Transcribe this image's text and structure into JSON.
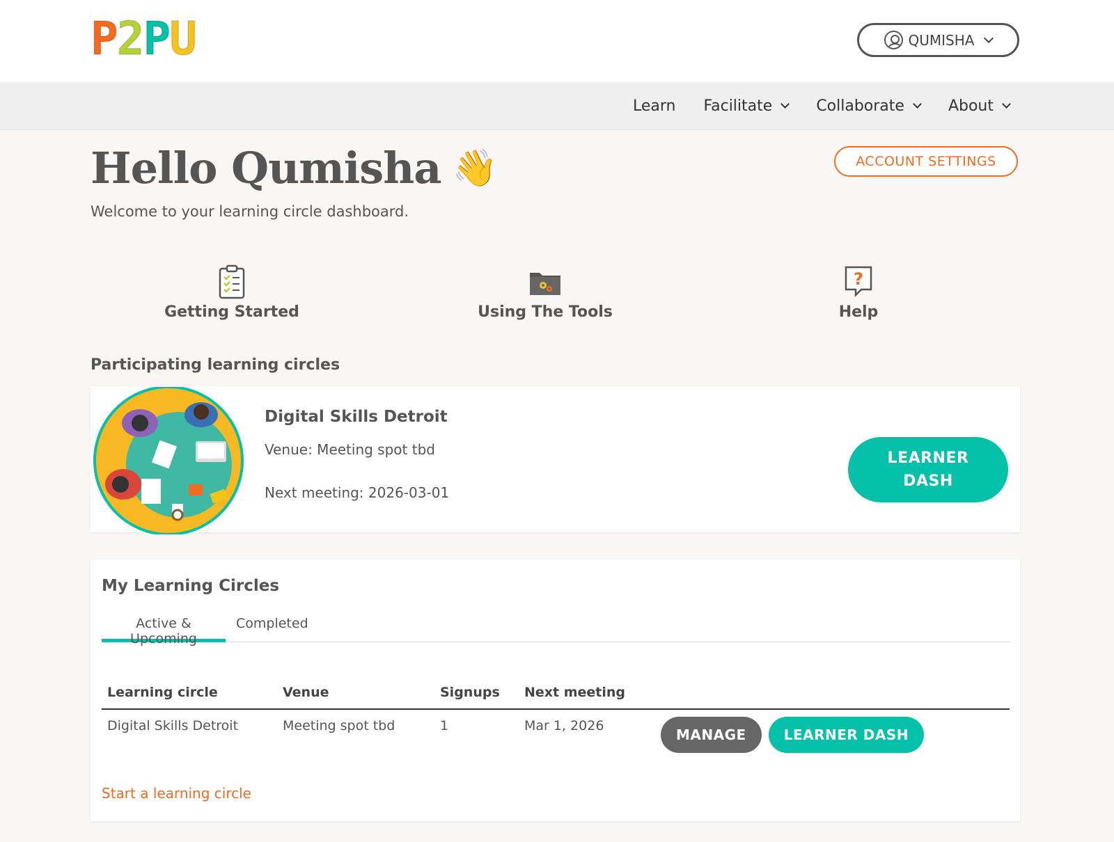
{
  "header": {
    "logo": [
      "P",
      "2",
      "P",
      "U"
    ],
    "logo_colors": [
      "#f26b21",
      "#b5d334",
      "#05c1a9",
      "#f5c41a"
    ],
    "user_label": "QUMISHA"
  },
  "nav": {
    "items": [
      {
        "label": "Learn",
        "has_dropdown": false
      },
      {
        "label": "Facilitate",
        "has_dropdown": true
      },
      {
        "label": "Collaborate",
        "has_dropdown": true
      },
      {
        "label": "About",
        "has_dropdown": true
      }
    ]
  },
  "page": {
    "greeting": "Hello Qumisha",
    "wave_emoji": "👋",
    "subtitle": "Welcome to your learning circle dashboard.",
    "account_settings": "ACCOUNT SETTINGS"
  },
  "quick_links": [
    {
      "label": "Getting Started",
      "icon": "clipboard-checklist-icon"
    },
    {
      "label": "Using The Tools",
      "icon": "folder-gears-icon"
    },
    {
      "label": "Help",
      "icon": "question-bubble-icon"
    }
  ],
  "participating": {
    "heading": "Participating learning circles",
    "card": {
      "title": "Digital Skills Detroit",
      "venue": "Venue: Meeting spot tbd",
      "next_meeting": "Next meeting: 2026-03-01",
      "button_line1": "LEARNER",
      "button_line2": "DASH"
    }
  },
  "my_circles": {
    "title": "My Learning Circles",
    "tabs": [
      "Active & Upcoming",
      "Completed"
    ],
    "columns": [
      "Learning circle",
      "Venue",
      "Signups",
      "Next meeting"
    ],
    "rows": [
      {
        "name": "Digital Skills Detroit",
        "venue": "Meeting spot tbd",
        "signups": "1",
        "next": "Mar 1, 2026",
        "manage": "MANAGE",
        "learner_dash": "LEARNER DASH"
      }
    ],
    "start_link": "Start a learning circle"
  },
  "colors": {
    "accent_teal": "#05c1a9",
    "accent_orange": "#f26b21",
    "dark_button": "#666666"
  }
}
